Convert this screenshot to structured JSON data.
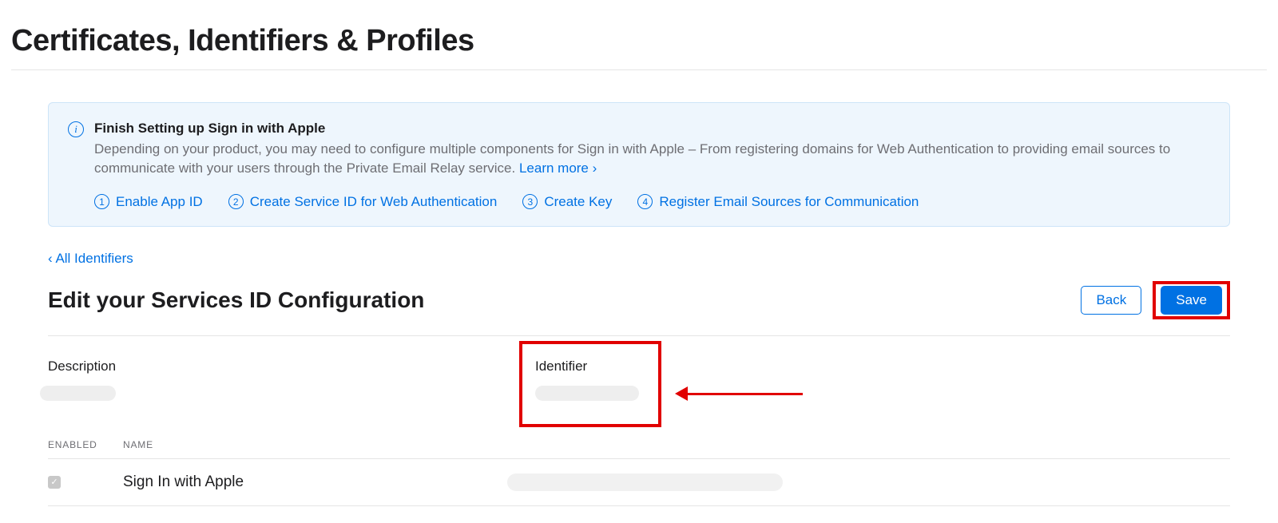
{
  "page_title": "Certificates, Identifiers & Profiles",
  "info": {
    "icon_glyph": "i",
    "title": "Finish Setting up Sign in with Apple",
    "description": "Depending on your product, you may need to configure multiple components for Sign in with Apple – From registering domains for Web Authentication to providing email sources to communicate with your users through the Private Email Relay service. ",
    "learn_more": "Learn more ›",
    "steps": [
      {
        "num": "1",
        "label": "Enable App ID"
      },
      {
        "num": "2",
        "label": "Create Service ID for Web Authentication"
      },
      {
        "num": "3",
        "label": "Create Key"
      },
      {
        "num": "4",
        "label": "Register Email Sources for Communication"
      }
    ]
  },
  "breadcrumb": "‹ All Identifiers",
  "section_title": "Edit your Services ID Configuration",
  "buttons": {
    "back": "Back",
    "save": "Save"
  },
  "fields": {
    "description_label": "Description",
    "identifier_label": "Identifier"
  },
  "capabilities": {
    "columns": {
      "enabled": "ENABLED",
      "name": "NAME"
    },
    "rows": [
      {
        "enabled": true,
        "name": "Sign In with Apple",
        "check_glyph": "✓"
      }
    ]
  }
}
